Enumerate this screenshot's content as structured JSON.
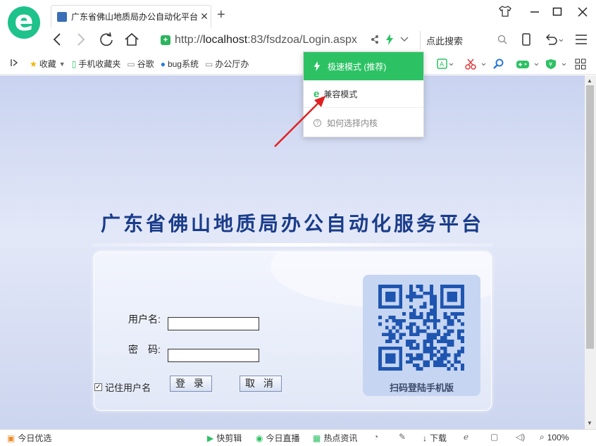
{
  "browser": {
    "tab_title": "广东省佛山地质局办公自动化平台",
    "new_tab": "+",
    "url_prefix": "http://",
    "url_host": "localhost",
    "url_rest": ":83/fsdzoa/Login.aspx",
    "search_placeholder": "点此搜索"
  },
  "bookmarks": [
    {
      "label": "收藏",
      "icon": "star-icon"
    },
    {
      "label": "手机收藏夹",
      "icon": "phone-icon"
    },
    {
      "label": "谷歌",
      "icon": "page-icon"
    },
    {
      "label": "bug系统",
      "icon": "globe-icon"
    },
    {
      "label": "办公厅办",
      "icon": "page-icon"
    }
  ],
  "dropdown": {
    "fast_mode": "极速模式 (推荐)",
    "compat_mode": "兼容模式",
    "help": "如何选择内核"
  },
  "page": {
    "heading": "广东省佛山地质局办公自动化服务平台",
    "username_label": "用户名:",
    "password_label": "密　码:",
    "remember_label": "记住用户名",
    "login_button": "登 录",
    "cancel_button": "取 消",
    "qr_caption": "扫码登陆手机版"
  },
  "status_bar": {
    "left": "今日优选",
    "items": [
      "快剪辑",
      "今日直播",
      "热点资讯",
      "下载"
    ],
    "zoom": "100%"
  },
  "colors": {
    "accent_green": "#2cc264",
    "heading_blue": "#1a3c8a",
    "arrow_red": "#e02020"
  }
}
